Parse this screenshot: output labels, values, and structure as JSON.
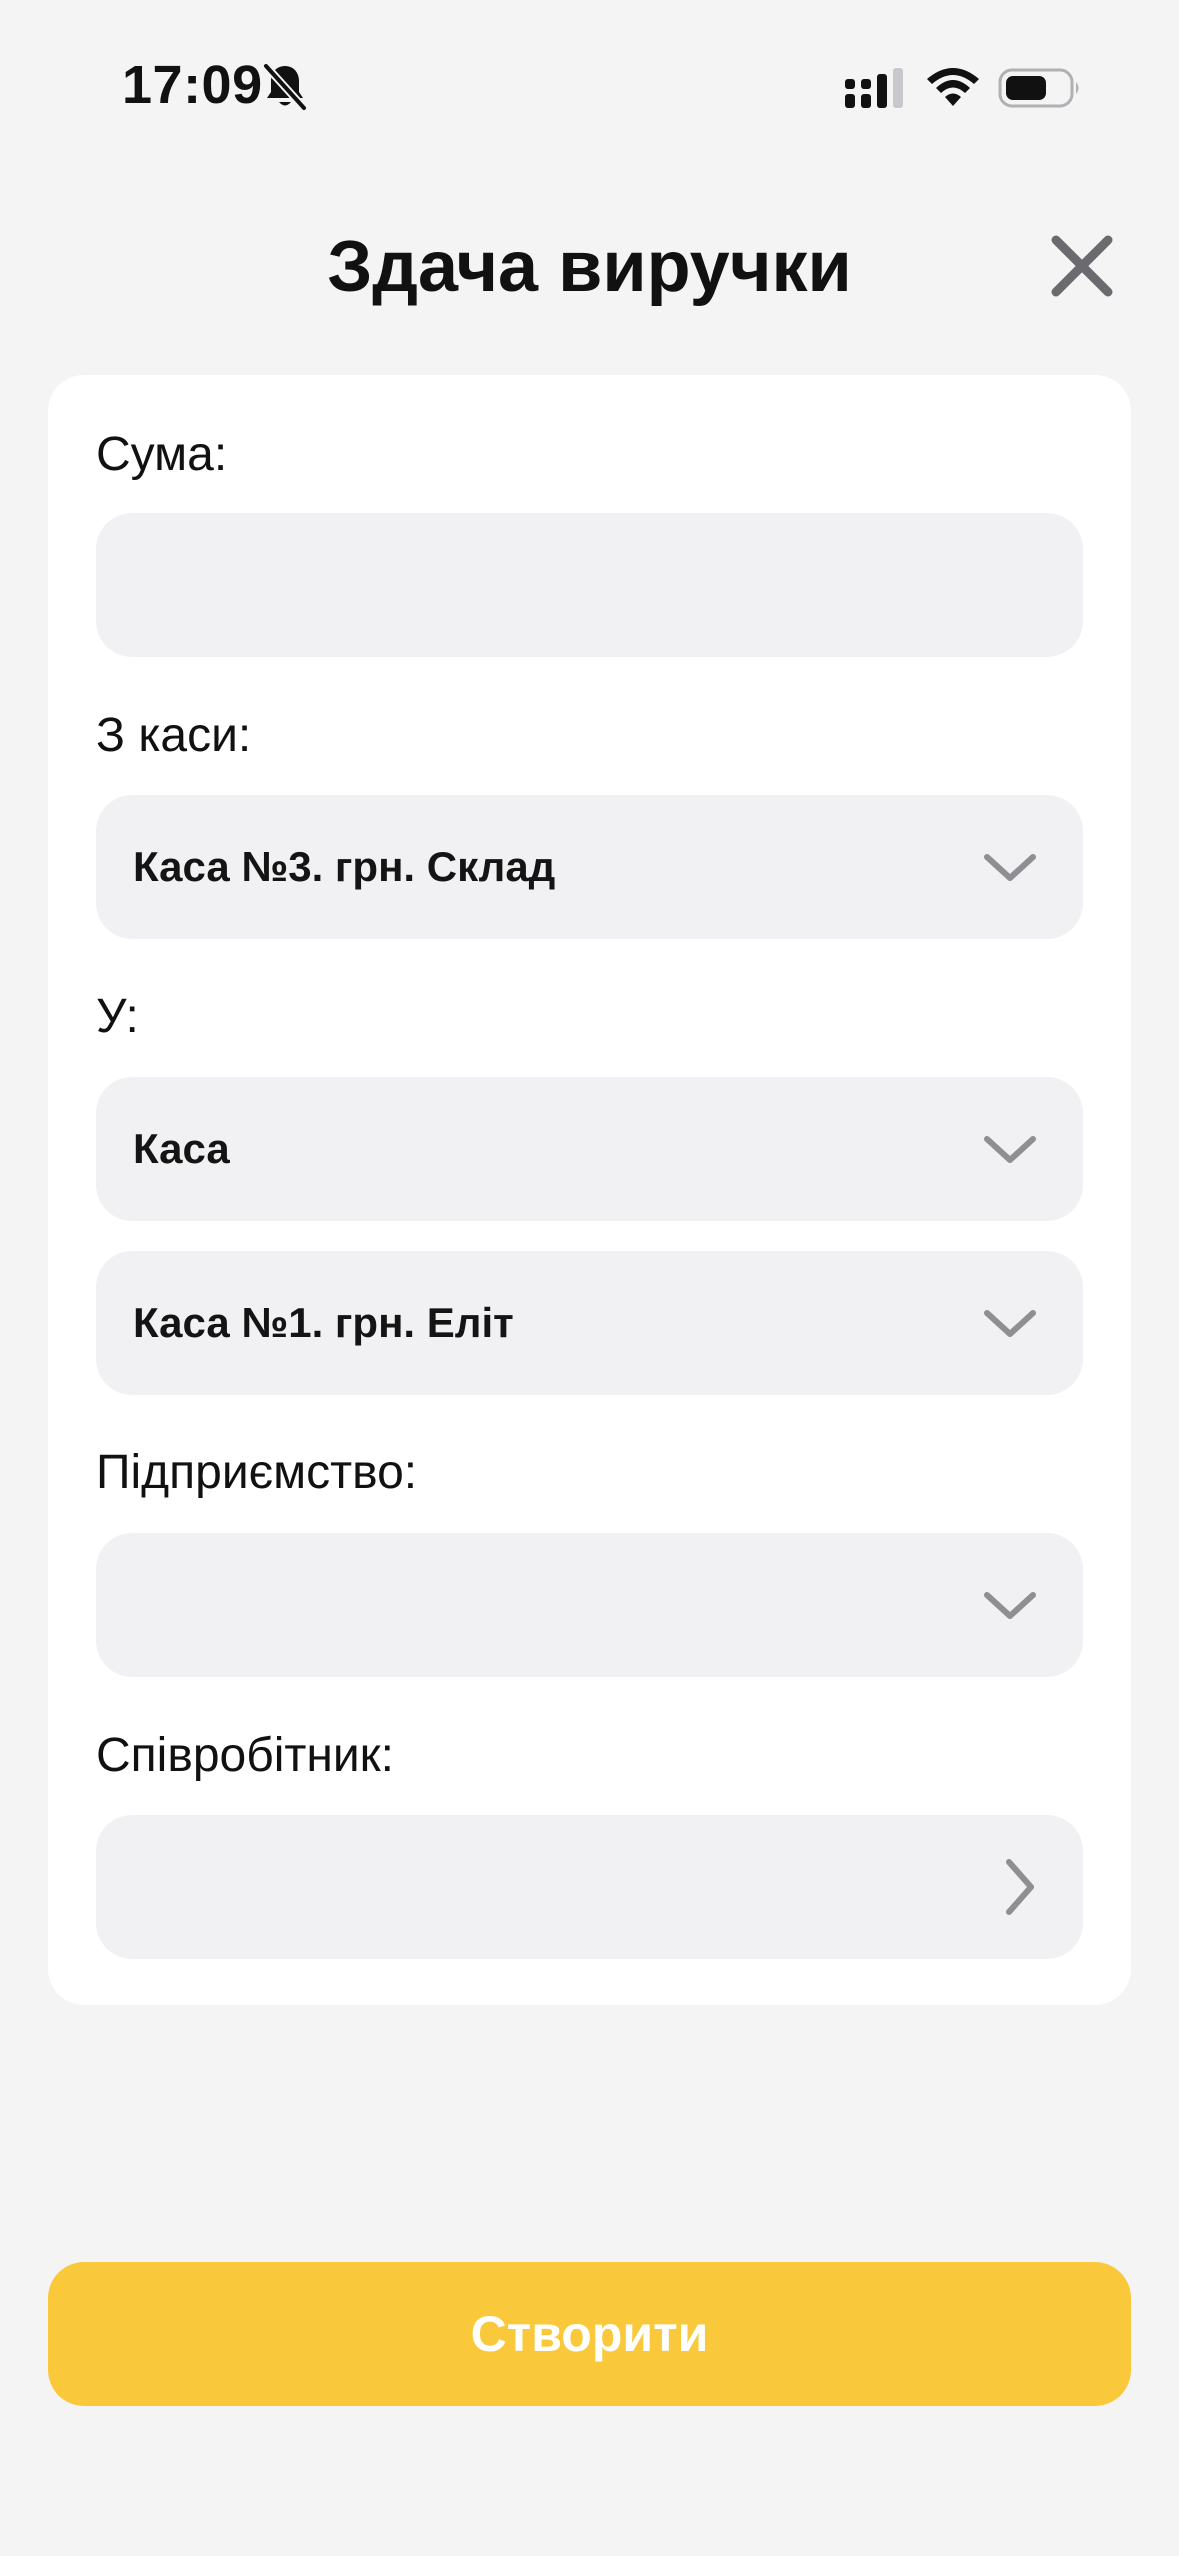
{
  "status_bar": {
    "time": "17:09",
    "icons": [
      "bell-slash-icon",
      "cellular-signal-icon",
      "wifi-icon",
      "battery-icon"
    ]
  },
  "header": {
    "title": "Здача виручки",
    "close_icon": "close-icon"
  },
  "form": {
    "amount": {
      "label": "Сума:",
      "value": ""
    },
    "from_cashbox": {
      "label": "З каси:",
      "value": "Каса №3. грн. Склад"
    },
    "to": {
      "label": "У:",
      "type_value": "Каса",
      "cashbox_value": "Каса №1. грн. Еліт"
    },
    "enterprise": {
      "label": "Підприємство:",
      "value": ""
    },
    "employee": {
      "label": "Співробітник:",
      "value": ""
    }
  },
  "actions": {
    "create_label": "Створити"
  },
  "colors": {
    "background": "#f4f4f5",
    "card": "#ffffff",
    "field": "#f1f1f3",
    "accent": "#f9c93b",
    "chevron": "#8e8e93"
  }
}
